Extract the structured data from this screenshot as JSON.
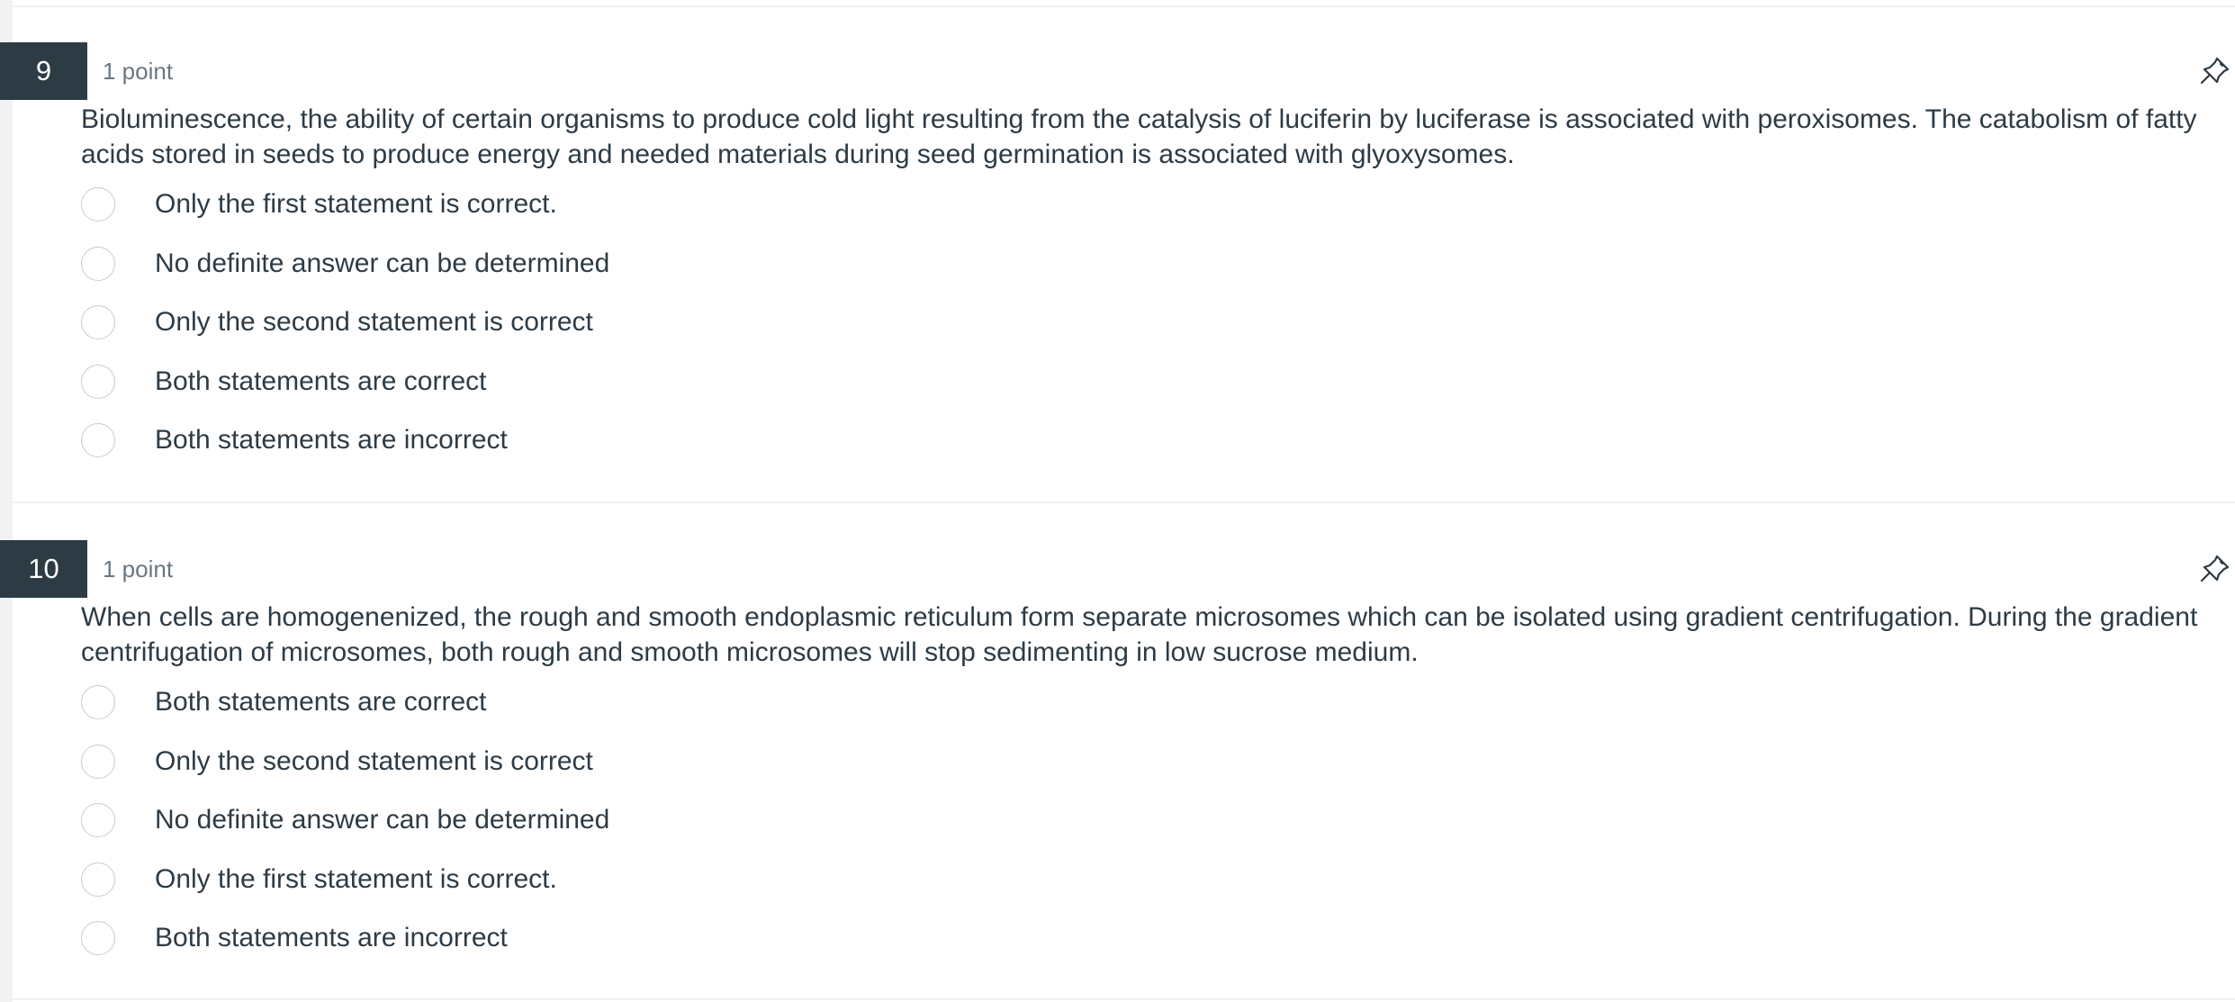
{
  "questions": [
    {
      "number": "9",
      "points": "1 point",
      "text": "Bioluminescence, the ability of certain organisms to produce cold light resulting from the catalysis of luciferin by luciferase is associated with peroxisomes.  The catabolism of fatty acids stored in seeds to produce energy and needed materials during seed germination is associated with glyoxysomes.",
      "answers": [
        "Only the first statement is correct.",
        "No definite answer can be determined",
        "Only the second statement is correct",
        "Both statements are correct",
        "Both statements are incorrect"
      ]
    },
    {
      "number": "10",
      "points": "1 point",
      "text": "When cells are homogenenized, the rough and smooth endoplasmic reticulum form separate microsomes which can be isolated using gradient centrifugation.  During the gradient centrifugation of microsomes, both rough and smooth microsomes will stop sedimenting in low sucrose medium.",
      "answers": [
        "Both statements are correct",
        "Only the second statement is correct",
        "No definite answer can be determined",
        "Only the first statement is correct.",
        "Both statements are incorrect"
      ]
    }
  ],
  "icons": {
    "pin": "pin-icon",
    "radio": "radio-button"
  },
  "colors": {
    "number_badge_bg": "#2d3b45",
    "text": "#2d3b45",
    "points_text": "#6b7780",
    "radio_border": "#c7cdd1"
  }
}
